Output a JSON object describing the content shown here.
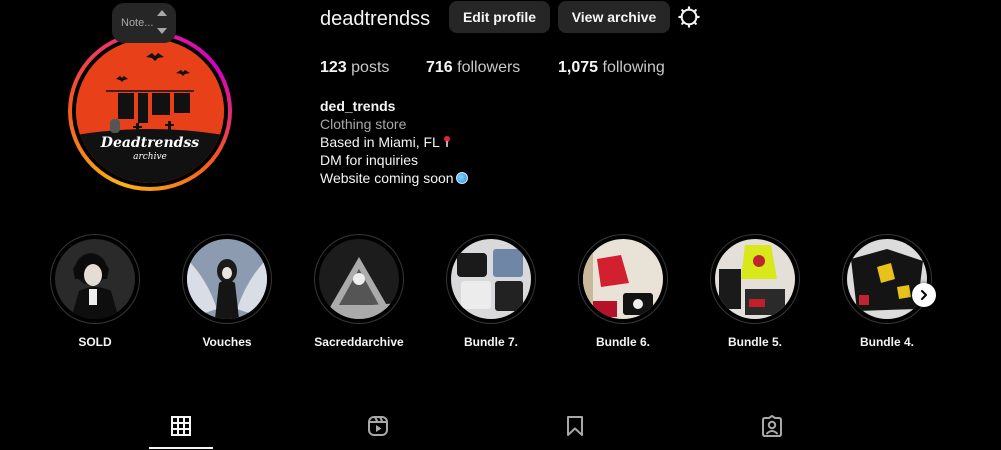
{
  "profile": {
    "username": "deadtrendss",
    "edit_profile_label": "Edit profile",
    "view_archive_label": "View archive",
    "note_text": "Note...",
    "avatar_title": "Deadtrendss",
    "avatar_subtitle": "archive"
  },
  "stats": {
    "posts_count": "123",
    "posts_label": "posts",
    "followers_count": "716",
    "followers_label": "followers",
    "following_count": "1,075",
    "following_label": "following"
  },
  "bio": {
    "name": "ded_trends",
    "category": "Clothing store",
    "line1": "Based in Miami, FL",
    "line2": "DM for inquiries",
    "line3": "Website coming soon"
  },
  "highlights": [
    {
      "label": "SOLD",
      "icon": "anime-character-thumbnail"
    },
    {
      "label": "Vouches",
      "icon": "anime-angel-thumbnail"
    },
    {
      "label": "Sacreddarchive",
      "icon": "graphic-thumbnail"
    },
    {
      "label": "Bundle 7.",
      "icon": "clothes-bundle-thumbnail"
    },
    {
      "label": "Bundle 6.",
      "icon": "clothes-bundle-thumbnail"
    },
    {
      "label": "Bundle 5.",
      "icon": "clothes-bundle-thumbnail"
    },
    {
      "label": "Bundle 4.",
      "icon": "clothes-bundle-thumbnail"
    }
  ],
  "tabs": [
    {
      "name": "posts",
      "icon": "grid-icon",
      "active": true
    },
    {
      "name": "reels",
      "icon": "reels-icon",
      "active": false
    },
    {
      "name": "saved",
      "icon": "bookmark-icon",
      "active": false
    },
    {
      "name": "tagged",
      "icon": "tagged-icon",
      "active": false
    }
  ],
  "colors": {
    "background": "#000000",
    "button": "#262626",
    "secondary_text": "#a8a8a8",
    "avatar_red": "#e8411a"
  }
}
